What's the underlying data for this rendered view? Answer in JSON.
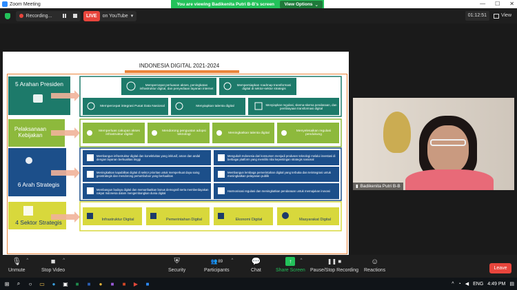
{
  "window": {
    "title": "Zoom Meeting",
    "minimize": "—",
    "maximize": "☐",
    "close": "✕"
  },
  "share_banner": {
    "message": "You are viewing Badikenita Putri B-B's screen",
    "view_options": "View Options",
    "caret": "⌄"
  },
  "top": {
    "recording_label": "Recording...",
    "live_badge": "LIVE",
    "live_on": "on YouTube",
    "live_caret": "▾",
    "timer": "01:12:51",
    "view_label": "View"
  },
  "slide": {
    "title": "INDONESIA DIGITAL 2021-2024",
    "sections": [
      {
        "label": "5 Arahan Presiden",
        "color": "#1d7a6a",
        "text_color": "#ffffff"
      },
      {
        "label": "Pelaksanaan Kebijakan",
        "color": "#8db93c",
        "text_color": "#ffffff"
      },
      {
        "label": "6 Arah Strategis",
        "color": "#1c4f8a",
        "text_color": "#ffffff"
      },
      {
        "label": "4 Sektor Strategis",
        "color": "#d8d83c",
        "text_color": "#1d3b6a"
      }
    ],
    "arahan": [
      "Mempercepat perluasan akses, peningkatan infrastruktur digital, dan penyediaan layanan internet",
      "Mempersiapkan roadmap transformasi digital di sektor-sektor strategis",
      "Mempercepat integrasi Pusat Data Nasional",
      "Menyiapkan talenta digital",
      "Menyiapkan regulasi, skema-skema pendanaan, dan pembiayaan transformasi digital"
    ],
    "kebijakan": [
      "Memperluas cakupan akses infrastruktur digital",
      "Mendorong penguatan adopsi teknologi",
      "Meningkatkan talenta digital",
      "Menyelesaikan regulasi pendukung"
    ],
    "strategis": [
      "Membangun infrastruktur digital dan konektivitas yang inklusif, aman dan andal dengan layanan berkualitas tinggi",
      "Mengubah Indonesia dari konsumen menjadi produsen teknologi melalui investasi di berbagai platform yang memiliki nilai kepentingan strategis nasional",
      "Meningkatkan kapabilitas digital di sektor prioritas untuk memperkuat daya saing geostrategis dan mendorong pertumbuhan yang berkualitas",
      "Membangun lembaga pemerintahan digital yang terbuka dan terintegrasi untuk meningkatkan pelayanan publik",
      "Membangun budaya digital dan memanfaatkan bonus demografi serta memberdayakan rakyat Indonesia dalam mengembangkan dunia digital",
      "Harmonisasi regulasi dan meningkatkan pendanaan untuk memajukan inovasi"
    ],
    "sektor": [
      "Infrastruktur Digital",
      "Pemerintahan Digital",
      "Ekonomi Digital",
      "Masyarakat Digital"
    ]
  },
  "video": {
    "participant_name": "Badikenita Putri B-B"
  },
  "toolbar": {
    "unmute": "Unmute",
    "stop_video": "Stop Video",
    "security": "Security",
    "participants": "Participants",
    "participants_count": "89",
    "chat": "Chat",
    "share_screen": "Share Screen",
    "pause_recording": "Pause/Stop Recording",
    "reactions": "Reactions",
    "leave": "Leave",
    "caret": "^"
  },
  "taskbar": {
    "lang": "ENG",
    "time": "4:49 PM"
  }
}
